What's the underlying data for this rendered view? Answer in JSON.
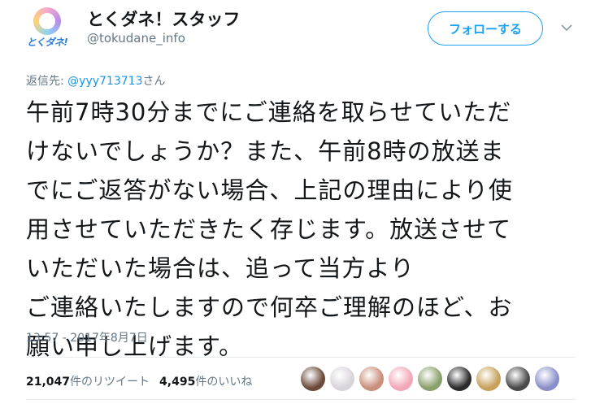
{
  "header": {
    "display_name": "とくダネ！スタッフ",
    "screen_name": "@tokudane_info",
    "avatar_logo": "とくダネ!",
    "follow_label": "フォローする"
  },
  "reply": {
    "prefix": "返信先: ",
    "handle": "@yyy713713",
    "suffix": "さん"
  },
  "tweet": {
    "lines": [
      "午前7時30分までにご連絡を取らせていただ",
      "けないでしょうか？また、午前8時の放送ま",
      "でにご返答がない場合、上記の理由により使",
      "用させていただきたく存じます。放送させて",
      "いただいた場合は、追って当方より",
      "ご連絡いたしますので何卒ご理解のほど、お",
      "願い申し上げます。"
    ],
    "timestamp": "13:57 - 2017年8月7日"
  },
  "stats": {
    "retweets_count": "21,047",
    "retweets_label": "件のリツイート",
    "likes_count": "4,495",
    "likes_label": "件のいいね"
  },
  "likers": [
    {
      "color": "#6b4a3a"
    },
    {
      "color": "#d9d4dc"
    },
    {
      "color": "#c98f7a"
    },
    {
      "color": "#f2a7b8"
    },
    {
      "color": "#8aa06a"
    },
    {
      "color": "#2b2b2b"
    },
    {
      "color": "#c7a15a"
    },
    {
      "color": "#4a4a4a"
    },
    {
      "color": "#8a8fc9"
    }
  ],
  "colors": {
    "accent": "#1da1f2",
    "link": "#1b95e0",
    "muted": "#657786"
  }
}
